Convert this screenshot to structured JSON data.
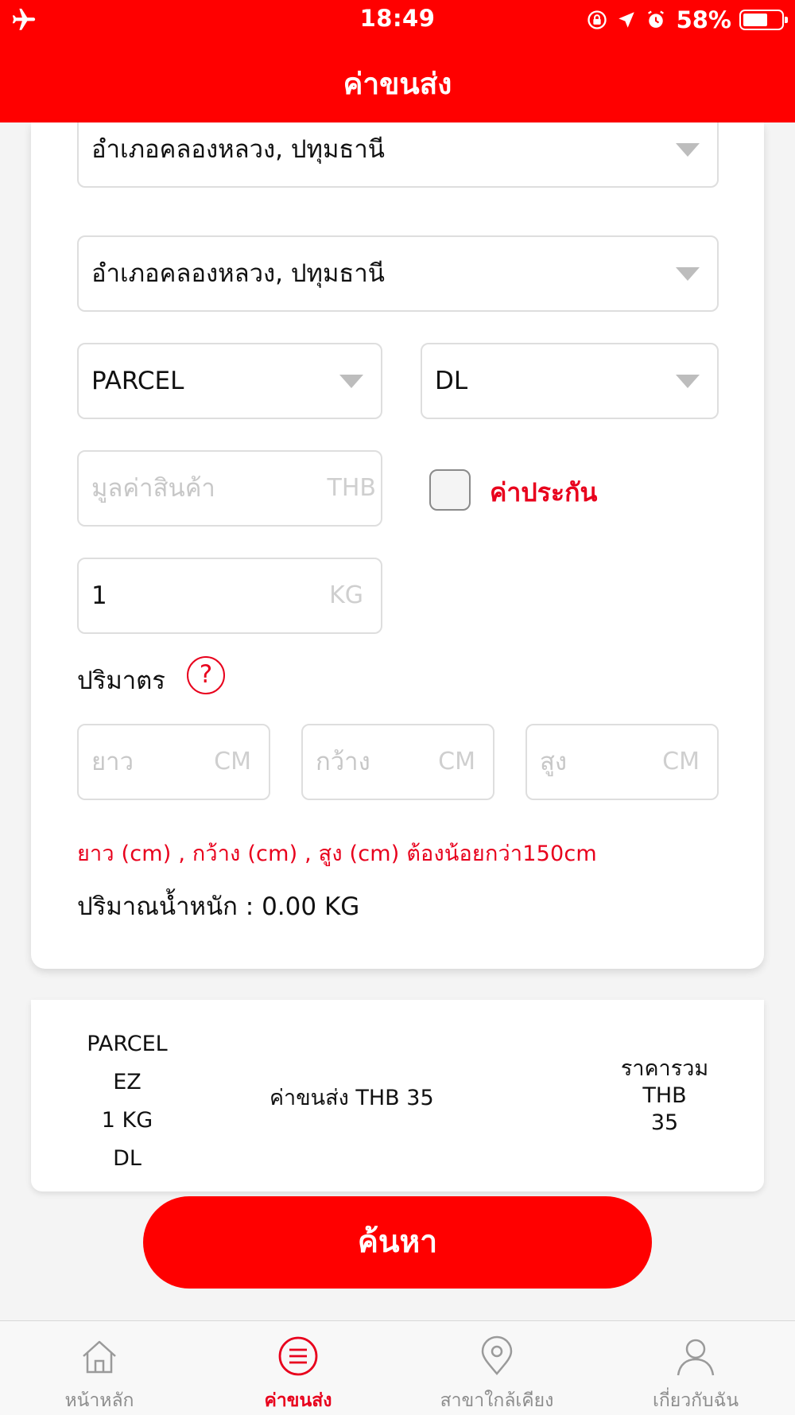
{
  "status_bar": {
    "time": "18:49",
    "battery": "58%"
  },
  "header": {
    "title": "ค่าขนส่ง"
  },
  "form": {
    "origin": "อำเภอคลองหลวง, ปทุมธานี",
    "destination": "อำเภอคลองหลวง, ปทุมธานี",
    "package_type": "PARCEL",
    "service": "DL",
    "goods_value_placeholder": "มูลค่าสินค้า",
    "goods_value_unit": "THB",
    "insurance_label": "ค่าประกัน",
    "weight_value": "1",
    "weight_unit": "KG",
    "volume_label": "ปริมาตร",
    "help": "?",
    "length_placeholder": "ยาว",
    "width_placeholder": "กว้าง",
    "height_placeholder": "สูง",
    "dimension_unit": "CM",
    "warning": "ยาว (cm) , กว้าง (cm) , สูง (cm) ต้องน้อยกว่า150cm",
    "volumetric_weight": "ปริมาณน้ำหนัก : 0.00 KG"
  },
  "summary": {
    "type": "PARCEL",
    "service_code": "EZ",
    "weight": "1 KG",
    "service": "DL",
    "shipping_cost": "ค่าขนส่ง THB 35",
    "total_label": "ราคารวม",
    "total_currency": "THB",
    "total_value": "35"
  },
  "search_button": "ค้นหา",
  "tabs": [
    {
      "label": "หน้าหลัก",
      "icon": "home-icon",
      "active": false
    },
    {
      "label": "ค่าขนส่ง",
      "icon": "menu-icon",
      "active": true
    },
    {
      "label": "สาขาใกล้เคียง",
      "icon": "location-pin-icon",
      "active": false
    },
    {
      "label": "เกี่ยวกับฉัน",
      "icon": "user-icon",
      "active": false
    }
  ],
  "colors": {
    "brand": "#ff0000",
    "alert_text": "#e8001c",
    "inactive_tab": "#8d8d8d"
  }
}
